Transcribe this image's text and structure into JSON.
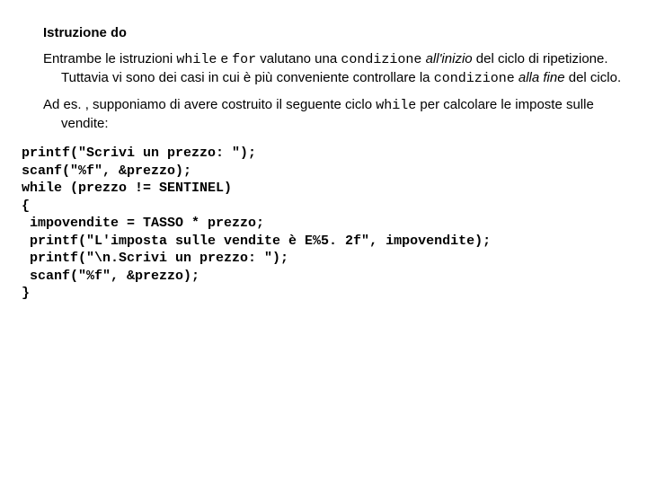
{
  "heading": {
    "prefix": "Istruzione ",
    "keyword": "do"
  },
  "para1": {
    "t1": "Entrambe le istruzioni ",
    "kw_while": "while",
    "t2": " e ",
    "kw_for": "for",
    "t3": " valutano una ",
    "kw_cond": "condizione",
    "t4_italic": "all'inizio",
    "t4_rest": " del ciclo di ripetizione. Tuttavia vi sono dei casi in cui è più conveniente controllare la ",
    "kw_cond2": "condizione",
    "t5": " ",
    "t5_italic": "alla fine",
    "t5_rest": " del ciclo."
  },
  "para2": {
    "t1": "Ad es. , supponiamo di avere costruito il seguente ciclo ",
    "kw_while": "while",
    "t2": " per calcolare le imposte sulle vendite:"
  },
  "code": "printf(\"Scrivi un prezzo: \");\nscanf(\"%f\", &prezzo);\nwhile (prezzo != SENTINEL)\n{\n impovendite = TASSO * prezzo;\n printf(\"L'imposta sulle vendite è E%5. 2f\", impovendite);\n printf(\"\\n.Scrivi un prezzo: \");\n scanf(\"%f\", &prezzo);\n}"
}
